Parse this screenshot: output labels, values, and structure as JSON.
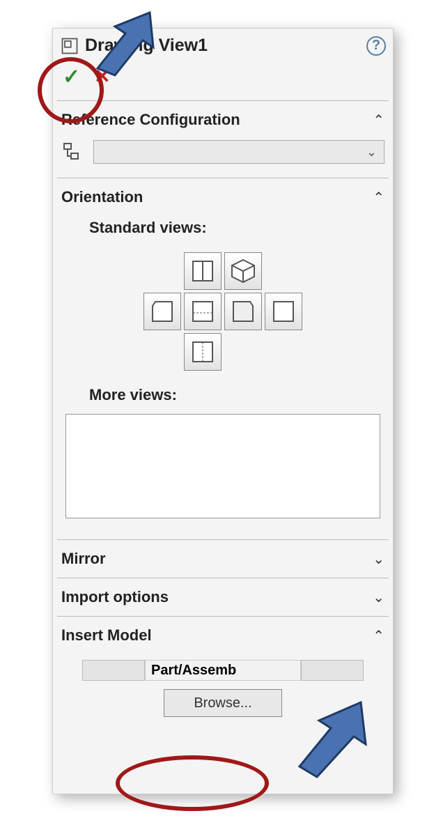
{
  "header": {
    "title": "Drawing View1"
  },
  "sections": {
    "reference_configuration": {
      "label": "Reference Configuration"
    },
    "orientation": {
      "label": "Orientation",
      "standard_views_label": "Standard views:",
      "more_views_label": "More views:"
    },
    "mirror": {
      "label": "Mirror"
    },
    "import_options": {
      "label": "Import options"
    },
    "insert_model": {
      "label": "Insert Model",
      "part_assembly_label": "Part/Assemb",
      "browse_label": "Browse..."
    }
  }
}
